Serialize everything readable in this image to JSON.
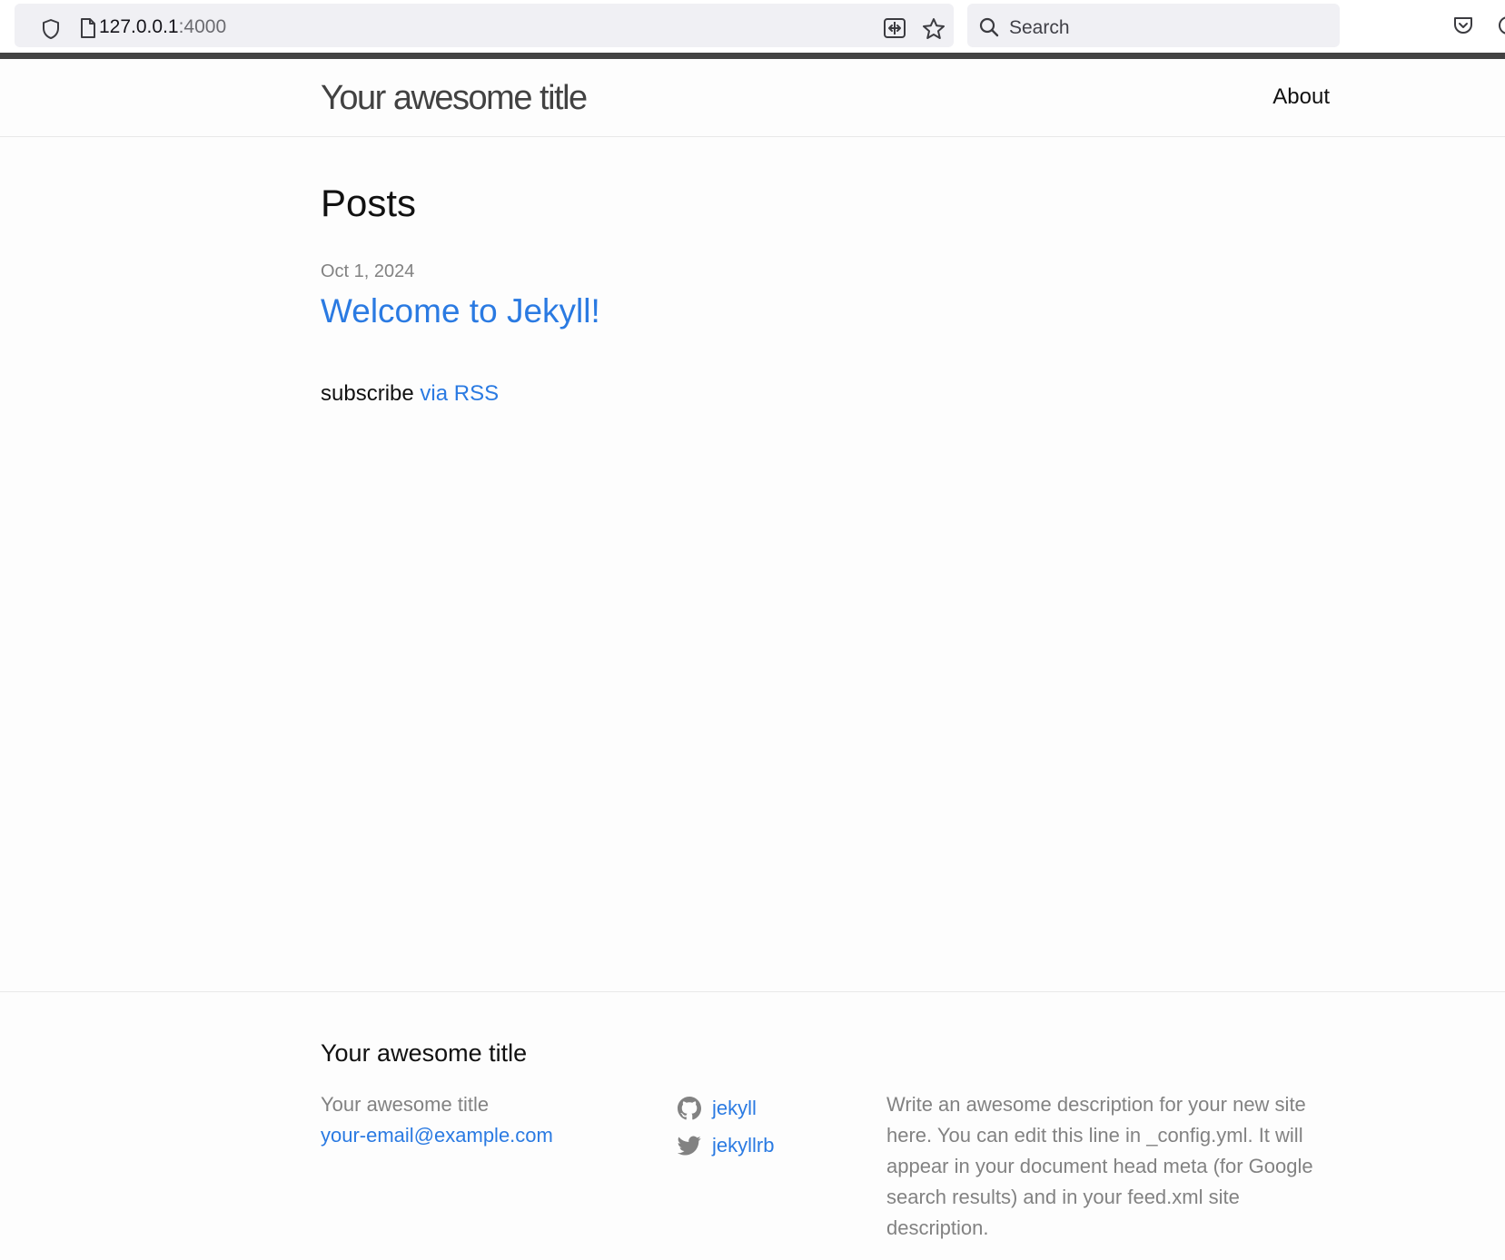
{
  "browser": {
    "url_host": "127.0.0.1",
    "url_port": ":4000",
    "search_placeholder": "Search"
  },
  "site": {
    "title": "Your awesome title",
    "nav": [
      {
        "label": "About"
      }
    ]
  },
  "main": {
    "heading": "Posts",
    "posts": [
      {
        "date": "Oct 1, 2024",
        "title": "Welcome to Jekyll!"
      }
    ],
    "rss_prefix": "subscribe ",
    "rss_link": "via RSS"
  },
  "footer": {
    "heading": "Your awesome title",
    "name": "Your awesome title",
    "email": "your-email@example.com",
    "social": [
      {
        "icon": "github-icon",
        "label": "jekyll"
      },
      {
        "icon": "twitter-icon",
        "label": "jekyllrb"
      }
    ],
    "description": "Write an awesome description for your new site here. You can edit this line in _config.yml. It will appear in your document head meta (for Google search results) and in your feed.xml site description."
  },
  "colors": {
    "link": "#2a7ae2",
    "muted": "#828282",
    "border_top": "#424242"
  }
}
